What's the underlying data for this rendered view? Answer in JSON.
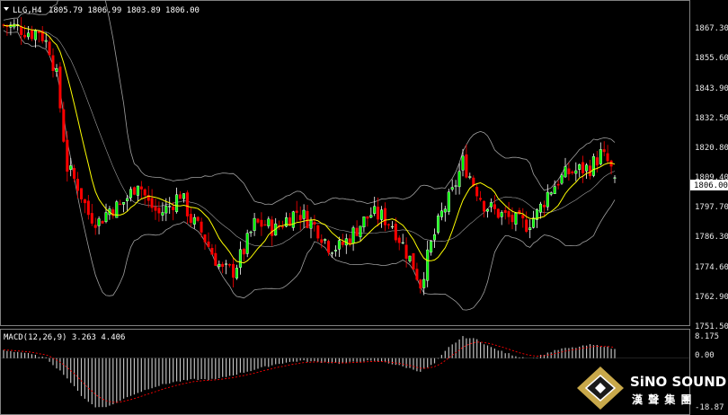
{
  "header": {
    "symbol": "LLG,H4",
    "ohlc": "1805.79 1806.99 1803.89 1806.00"
  },
  "macd_header": {
    "label": "MACD(12,26,9) 3.263 4.406"
  },
  "price_axis": {
    "ticks": [
      "1867.30",
      "1855.60",
      "1843.90",
      "1832.50",
      "1820.80",
      "1809.40",
      "1797.70",
      "1786.30",
      "1774.60",
      "1762.90",
      "1751.50"
    ],
    "current_price": "1806.00"
  },
  "macd_axis": {
    "ticks": [
      "8.175",
      "0.00",
      "-18.87"
    ]
  },
  "logo": {
    "name": "SiNO SOUND",
    "subtitle": "漢 聲 集 團"
  },
  "colors": {
    "background": "#000000",
    "bull": "#ffffff",
    "bear": "#ff0000",
    "bull_body": "#00ff00",
    "ma": "#ffff00",
    "bands": "#a0a0a0",
    "macd_hist": "#c0c0c0",
    "macd_signal": "#ff0000"
  },
  "chart_data": {
    "type": "candlestick",
    "title": "LLG,H4",
    "ylim": [
      1749,
      1874
    ],
    "price_keypoints": [
      [
        0,
        1865
      ],
      [
        4,
        1864
      ],
      [
        8,
        1862
      ],
      [
        10,
        1863
      ],
      [
        13,
        1856
      ],
      [
        15,
        1845
      ],
      [
        18,
        1810
      ],
      [
        21,
        1803
      ],
      [
        24,
        1792
      ],
      [
        27,
        1789
      ],
      [
        30,
        1794
      ],
      [
        33,
        1795
      ],
      [
        36,
        1800
      ],
      [
        38,
        1805
      ],
      [
        41,
        1796
      ],
      [
        44,
        1792
      ],
      [
        47,
        1795
      ],
      [
        50,
        1800
      ],
      [
        53,
        1790
      ],
      [
        56,
        1785
      ],
      [
        59,
        1777
      ],
      [
        62,
        1770
      ],
      [
        65,
        1770
      ],
      [
        68,
        1778
      ],
      [
        71,
        1788
      ],
      [
        74,
        1788
      ],
      [
        77,
        1786
      ],
      [
        80,
        1790
      ],
      [
        83,
        1793
      ],
      [
        86,
        1790
      ],
      [
        89,
        1786
      ],
      [
        92,
        1780
      ],
      [
        95,
        1779
      ],
      [
        98,
        1783
      ],
      [
        101,
        1788
      ],
      [
        104,
        1792
      ],
      [
        107,
        1791
      ],
      [
        110,
        1788
      ],
      [
        113,
        1780
      ],
      [
        116,
        1772
      ],
      [
        118,
        1765
      ],
      [
        121,
        1780
      ],
      [
        124,
        1792
      ],
      [
        127,
        1800
      ],
      [
        130,
        1812
      ],
      [
        133,
        1804
      ],
      [
        136,
        1796
      ],
      [
        139,
        1793
      ],
      [
        142,
        1791
      ],
      [
        145,
        1789
      ],
      [
        148,
        1788
      ],
      [
        151,
        1792
      ],
      [
        154,
        1800
      ],
      [
        157,
        1805
      ],
      [
        160,
        1808
      ],
      [
        163,
        1809
      ],
      [
        166,
        1810
      ],
      [
        169,
        1815
      ],
      [
        171,
        1812
      ],
      [
        173,
        1806
      ]
    ],
    "macd_ylim": [
      -20,
      9
    ],
    "macd_keypoints": [
      [
        0,
        3
      ],
      [
        6,
        2
      ],
      [
        12,
        0
      ],
      [
        17,
        -6
      ],
      [
        22,
        -14
      ],
      [
        26,
        -18.5
      ],
      [
        30,
        -18
      ],
      [
        36,
        -14
      ],
      [
        42,
        -11
      ],
      [
        48,
        -9
      ],
      [
        54,
        -8
      ],
      [
        60,
        -8
      ],
      [
        66,
        -6
      ],
      [
        72,
        -4
      ],
      [
        78,
        -2
      ],
      [
        84,
        -1
      ],
      [
        90,
        -1.5
      ],
      [
        96,
        -2
      ],
      [
        102,
        -1
      ],
      [
        108,
        -1.5
      ],
      [
        114,
        -3.5
      ],
      [
        118,
        -5
      ],
      [
        122,
        -2
      ],
      [
        126,
        4
      ],
      [
        130,
        8
      ],
      [
        134,
        7
      ],
      [
        138,
        4
      ],
      [
        142,
        2
      ],
      [
        146,
        0.5
      ],
      [
        150,
        0
      ],
      [
        154,
        2
      ],
      [
        158,
        3.5
      ],
      [
        162,
        4
      ],
      [
        166,
        5
      ],
      [
        170,
        4.5
      ],
      [
        173,
        3.3
      ]
    ],
    "macd_value": 3.263,
    "signal_value": 4.406
  }
}
